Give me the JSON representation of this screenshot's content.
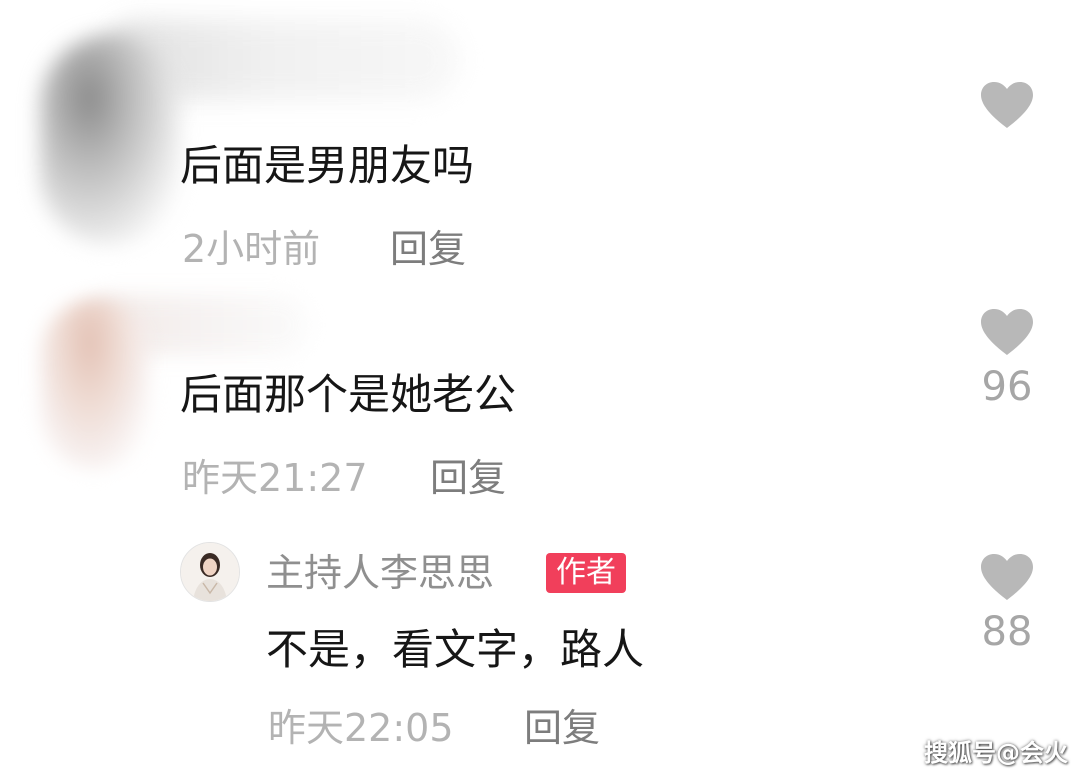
{
  "comments": [
    {
      "text": "后面是男朋友吗",
      "time": "2小时前",
      "reply_label": "回复",
      "like_count": ""
    },
    {
      "text": "后面那个是她老公",
      "time": "昨天21:27",
      "reply_label": "回复",
      "like_count": "96",
      "replies": [
        {
          "username": "主持人李思思",
          "badge": "作者",
          "text": "不是，看文字，路人",
          "time": "昨天22:05",
          "reply_label": "回复",
          "like_count": "88"
        }
      ]
    }
  ],
  "watermark": "搜狐号@会火",
  "colors": {
    "author_badge": "#f13f5b",
    "like_icon": "#b8b8b8",
    "meta_text": "#b3b3b3"
  },
  "icons": {
    "like": "heart-icon"
  }
}
